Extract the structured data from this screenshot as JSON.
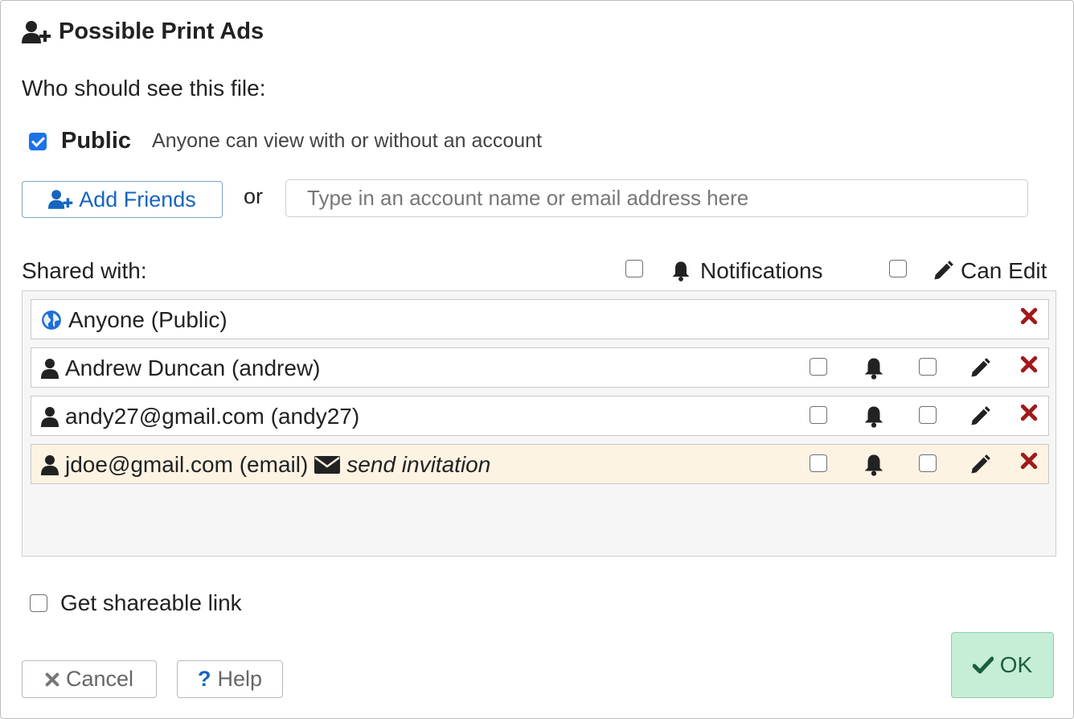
{
  "dialog": {
    "title": "Possible Print Ads",
    "who_label": "Who should see this file:"
  },
  "public_option": {
    "checked": true,
    "label": "Public",
    "description": "Anyone can view with or without an account"
  },
  "add_friends": {
    "button_label": "Add Friends",
    "or_label": "or",
    "search_placeholder": "Type in an account name or email address here",
    "search_value": ""
  },
  "shared": {
    "label": "Shared with:",
    "notifications_header": "Notifications",
    "can_edit_header": "Can Edit",
    "rows": [
      {
        "name": "Anyone (Public)",
        "icon": "globe-icon",
        "has_options": false
      },
      {
        "name": "Andrew Duncan (andrew)",
        "icon": "user-icon",
        "has_options": true,
        "notifications": false,
        "can_edit": false
      },
      {
        "name": "andy27@gmail.com (andy27)",
        "icon": "user-icon",
        "has_options": true,
        "notifications": false,
        "can_edit": false
      },
      {
        "name": "jdoe@gmail.com (email)",
        "icon": "user-icon",
        "invite_label": "send invitation",
        "has_options": true,
        "notifications": false,
        "can_edit": false,
        "pending": true
      }
    ]
  },
  "shareable_link": {
    "label": "Get shareable link",
    "checked": false
  },
  "footer": {
    "cancel_label": "Cancel",
    "help_label": "Help",
    "ok_label": "OK"
  },
  "colors": {
    "accent_blue": "#1565c0",
    "checkbox_blue": "#1a73e8",
    "remove_red": "#a11a1a",
    "ok_bg": "#c6eed7",
    "ok_text": "#1b5e3b",
    "pending_row_bg": "#fdf3e3"
  }
}
